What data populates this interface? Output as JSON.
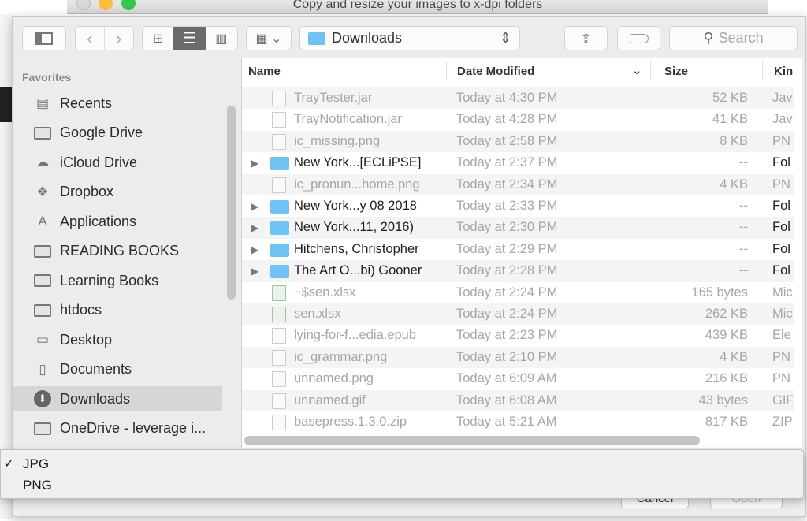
{
  "background_window": {
    "title": "Copy and resize your images to x-dpi folders"
  },
  "toolbar": {
    "location": "Downloads",
    "search_placeholder": "Search",
    "view_mode": "list"
  },
  "sidebar": {
    "heading": "Favorites",
    "items": [
      {
        "label": "Recents",
        "icon": "recents-icon"
      },
      {
        "label": "Google Drive",
        "icon": "folder-icon"
      },
      {
        "label": "iCloud Drive",
        "icon": "cloud-icon"
      },
      {
        "label": "Dropbox",
        "icon": "dropbox-icon"
      },
      {
        "label": "Applications",
        "icon": "applications-icon"
      },
      {
        "label": "READING BOOKS",
        "icon": "folder-icon"
      },
      {
        "label": "Learning Books",
        "icon": "folder-icon"
      },
      {
        "label": "htdocs",
        "icon": "folder-icon"
      },
      {
        "label": "Desktop",
        "icon": "desktop-icon"
      },
      {
        "label": "Documents",
        "icon": "documents-icon"
      },
      {
        "label": "Downloads",
        "icon": "downloads-icon",
        "selected": true
      },
      {
        "label": "OneDrive - leverage i...",
        "icon": "folder-icon"
      }
    ]
  },
  "columns": {
    "name": "Name",
    "date": "Date Modified",
    "size": "Size",
    "kind": "Kin"
  },
  "files": [
    {
      "name": "TrayTester.jar",
      "date": "Today at 4:30 PM",
      "size": "52 KB",
      "kind": "Jav",
      "type": "file"
    },
    {
      "name": "TrayNotification.jar",
      "date": "Today at 4:28 PM",
      "size": "41 KB",
      "kind": "Jav",
      "type": "file"
    },
    {
      "name": "ic_missing.png",
      "date": "Today at 2:58 PM",
      "size": "8 KB",
      "kind": "PN",
      "type": "file"
    },
    {
      "name": "New York...[ECLiPSE]",
      "date": "Today at 2:37 PM",
      "size": "--",
      "kind": "Fol",
      "type": "folder"
    },
    {
      "name": "ic_pronun...home.png",
      "date": "Today at 2:34 PM",
      "size": "4 KB",
      "kind": "PN",
      "type": "file"
    },
    {
      "name": "New York...y 08 2018",
      "date": "Today at 2:33 PM",
      "size": "--",
      "kind": "Fol",
      "type": "folder"
    },
    {
      "name": "New York...11, 2016)",
      "date": "Today at 2:30 PM",
      "size": "--",
      "kind": "Fol",
      "type": "folder"
    },
    {
      "name": "Hitchens, Christopher",
      "date": "Today at 2:29 PM",
      "size": "--",
      "kind": "Fol",
      "type": "folder"
    },
    {
      "name": "The Art O...bi) Gooner",
      "date": "Today at 2:28 PM",
      "size": "--",
      "kind": "Fol",
      "type": "folder"
    },
    {
      "name": "~$sen.xlsx",
      "date": "Today at 2:24 PM",
      "size": "165 bytes",
      "kind": "Mic",
      "type": "excel"
    },
    {
      "name": "sen.xlsx",
      "date": "Today at 2:24 PM",
      "size": "262 KB",
      "kind": "Mic",
      "type": "excel"
    },
    {
      "name": "lying-for-f...edia.epub",
      "date": "Today at 2:23 PM",
      "size": "439 KB",
      "kind": "Ele",
      "type": "file"
    },
    {
      "name": "ic_grammar.png",
      "date": "Today at 2:10 PM",
      "size": "4 KB",
      "kind": "PN",
      "type": "file"
    },
    {
      "name": "unnamed.png",
      "date": "Today at 6:09 AM",
      "size": "216 KB",
      "kind": "PN",
      "type": "file"
    },
    {
      "name": "unnamed.gif",
      "date": "Today at 6:08 AM",
      "size": "43 bytes",
      "kind": "GIF",
      "type": "file"
    },
    {
      "name": "basepress.1.3.0.zip",
      "date": "Today at 5:21 AM",
      "size": "817 KB",
      "kind": "ZIP",
      "type": "file"
    }
  ],
  "buttons": {
    "cancel": "Cancel",
    "open": "Open"
  },
  "format_menu": {
    "options": [
      "JPG",
      "PNG"
    ],
    "selected": "JPG"
  },
  "colors": {
    "folder": "#6ec3f4",
    "selection": "#d6d6d6"
  }
}
